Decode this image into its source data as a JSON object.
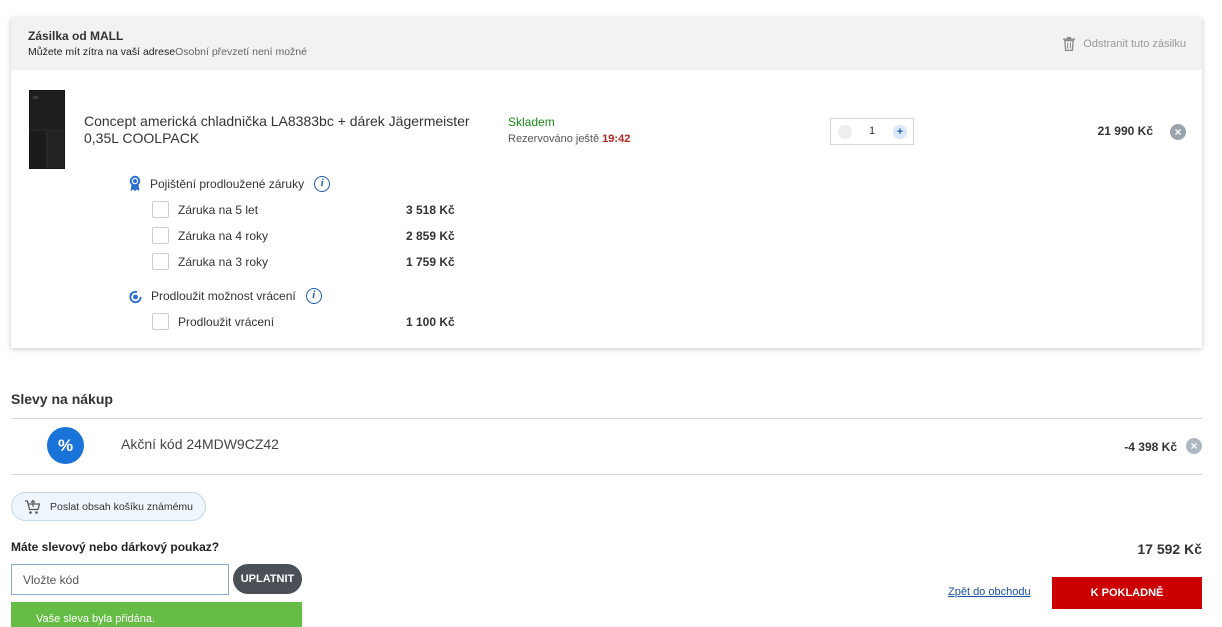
{
  "shipment": {
    "title": "Zásilka od MALL",
    "delivery": "Můžete mít zítra na vaší adrese",
    "pickup": "Osobní převzetí není možné",
    "remove_label": "Odstranit tuto zásilku",
    "remove_icon": "trash-icon"
  },
  "product": {
    "name": "Concept americká chladnička LA8383bc + dárek Jägermeister 0,35L COOLPACK",
    "stock": "Skladem",
    "reserved_label": "Rezervováno ještě",
    "reserved_time": "19:42",
    "quantity": "1",
    "qty_plus": "+",
    "price": "21 990 Kč",
    "remove_symbol": "×"
  },
  "services": {
    "warranty": {
      "title": "Pojištění prodloužené záruky",
      "icon": "ribbon-badge-icon",
      "info": "i",
      "options": [
        {
          "label": "Záruka na 5 let",
          "price": "3 518 Kč",
          "checked": false
        },
        {
          "label": "Záruka na 4 roky",
          "price": "2 859 Kč",
          "checked": false
        },
        {
          "label": "Záruka na 3 roky",
          "price": "1 759 Kč",
          "checked": false
        }
      ]
    },
    "returns": {
      "title": "Prodloužit možnost vrácení",
      "icon": "return-arrow-icon",
      "info": "i",
      "options": [
        {
          "label": "Prodloužit vrácení",
          "price": "1 100 Kč",
          "checked": false
        }
      ]
    }
  },
  "discounts": {
    "title": "Slevy na nákup",
    "badge": "%",
    "code_label": "Akční kód 24MDW9CZ42",
    "amount": "-4 398 Kč",
    "remove_symbol": "×"
  },
  "share": {
    "label": "Poslat obsah košíku známému",
    "icon": "cart-share-icon"
  },
  "voucher": {
    "question": "Máte slevový nebo dárkový poukaz?",
    "placeholder": "Vložte kód",
    "apply_label": "UPLATNIT",
    "success": "Vaše sleva byla přidána."
  },
  "summary": {
    "total": "17 592 Kč",
    "back_label": "Zpět do obchodu",
    "checkout_label": "K POKLADNĚ"
  },
  "colors": {
    "checkout": "#cc0000",
    "stock": "#1a8a1a",
    "reserved_time": "#b3261e",
    "discount_badge": "#1a73d9",
    "success": "#66bd45"
  }
}
